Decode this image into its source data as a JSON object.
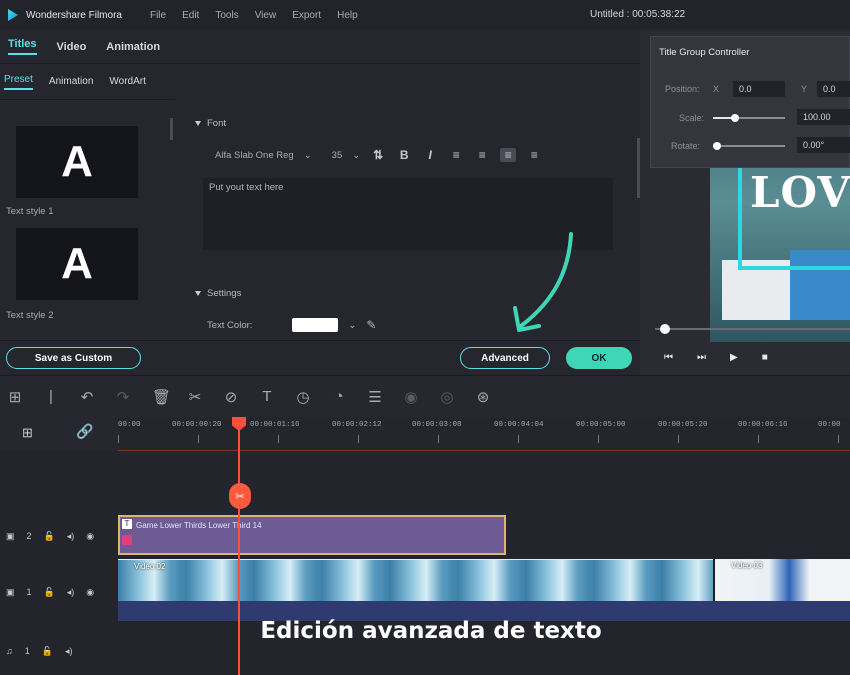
{
  "app": {
    "name": "Wondershare Filmora",
    "document_title": "Untitled : 00:05:38:22"
  },
  "menu": [
    "File",
    "Edit",
    "Tools",
    "View",
    "Export",
    "Help"
  ],
  "main_tabs": [
    "Titles",
    "Video",
    "Animation"
  ],
  "sub_tabs": [
    "Preset",
    "Animation",
    "WordArt"
  ],
  "presets": [
    {
      "glyph": "A",
      "label": "Text style 1"
    },
    {
      "glyph": "A",
      "label": "Text style 2"
    }
  ],
  "font_section": {
    "title": "Font",
    "font_name": "Alfa Slab One Reg",
    "font_size": "35",
    "bold": "B",
    "italic": "I",
    "text_placeholder": "Put yout text here"
  },
  "settings_section": {
    "title": "Settings",
    "text_color_label": "Text Color:",
    "text_color": "#ffffff"
  },
  "buttons": {
    "save_custom": "Save as Custom",
    "advanced": "Advanced",
    "ok": "OK"
  },
  "title_group_controller": {
    "title": "Title Group Controller",
    "position_label": "Position:",
    "x_label": "X",
    "x_value": "0.0",
    "y_label": "Y",
    "y_value": "0.0",
    "scale_label": "Scale:",
    "scale_value": "100.00",
    "rotate_label": "Rotate:",
    "rotate_value": "0.00°"
  },
  "preview_text": "LOV",
  "timeline": {
    "ticks": [
      "00:00",
      "00:00:00:20",
      "00:00:01:16",
      "00:00:02:12",
      "00:00:03:08",
      "00:00:04:04",
      "00:00:05:00",
      "00:00:05:20",
      "00:00:06:16",
      "00:00"
    ],
    "title_clip": "Game Lower Thirds Lower Third 14",
    "video_clip": "Video 02",
    "video_clip2": "Video 03",
    "tracks": [
      "2",
      "1",
      "1"
    ]
  },
  "caption": "Edición avanzada de texto",
  "colors": {
    "accent": "#58e1e6",
    "ok": "#3ed6b6",
    "playhead": "#ff4f3a",
    "arrow": "#3ed6b6"
  }
}
